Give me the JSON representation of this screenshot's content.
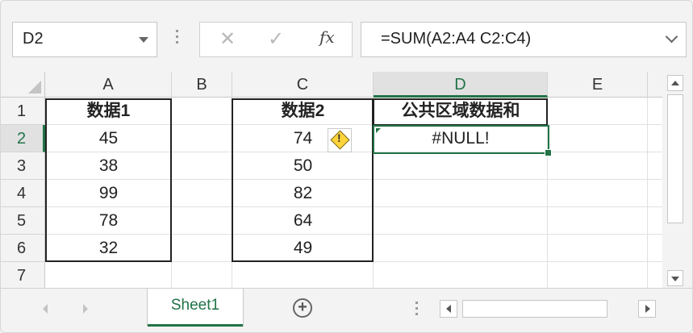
{
  "formula_bar": {
    "name_box": "D2",
    "cancel_icon": "✕",
    "enter_icon": "✓",
    "fx_label": "fx",
    "formula": "=SUM(A2:A4 C2:C4)"
  },
  "columns": [
    "A",
    "B",
    "C",
    "D",
    "E"
  ],
  "rows": [
    "1",
    "2",
    "3",
    "4",
    "5",
    "6",
    "7"
  ],
  "cells": {
    "A1": "数据1",
    "A2": "45",
    "A3": "38",
    "A4": "99",
    "A5": "78",
    "A6": "32",
    "C1": "数据2",
    "C2": "74",
    "C3": "50",
    "C4": "82",
    "C5": "64",
    "C6": "49",
    "D1": "公共区域数据和",
    "D2": "#NULL!"
  },
  "sheet_tabs": [
    "Sheet1"
  ],
  "colors": {
    "accent": "#217346",
    "header_bg": "#f3f3f3",
    "warning": "#ffd33a"
  },
  "icons": [
    "name-box-dropdown-icon",
    "cancel-icon",
    "enter-icon",
    "fx-icon",
    "formula-expand-icon",
    "error-warning-icon",
    "add-sheet-icon",
    "scroll-left-icon",
    "scroll-right-icon",
    "scroll-up-icon",
    "scroll-down-icon"
  ]
}
